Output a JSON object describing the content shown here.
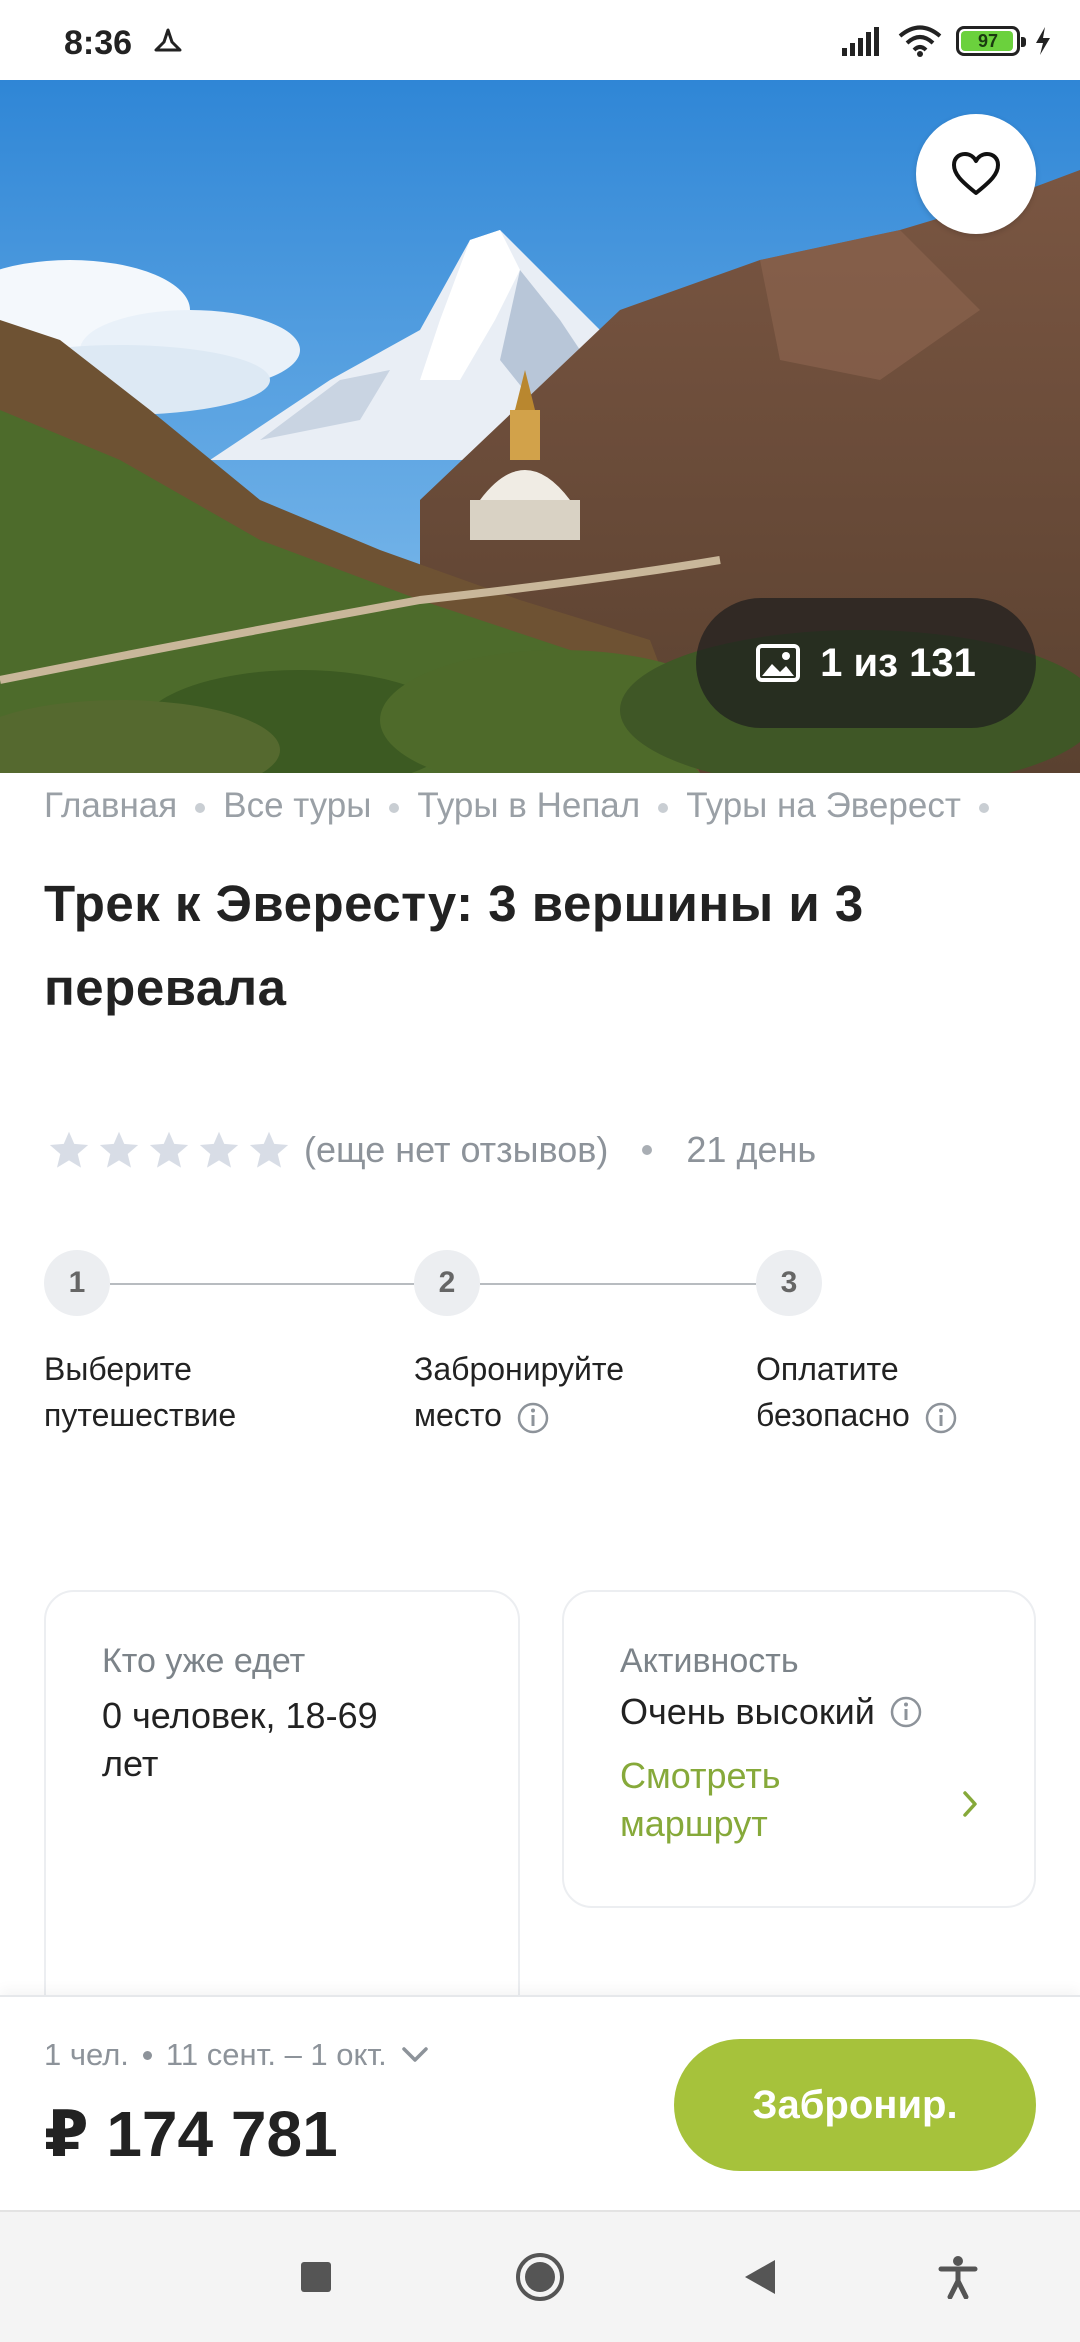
{
  "status_bar": {
    "time": "8:36",
    "battery": "97",
    "battery_level": 0.97
  },
  "hero": {
    "gallery_counter": "1 из 131"
  },
  "breadcrumb": [
    "Главная",
    "Все туры",
    "Туры в Непал",
    "Туры на Эверест"
  ],
  "tour": {
    "title": "Трек к Эвересту: 3 вершины и 3 перевала",
    "rating": 0,
    "rating_max": 5,
    "reviews_text": "(еще нет отзывов)",
    "duration": "21 день"
  },
  "steps": [
    {
      "number": "1",
      "label_line1": "Выберите",
      "label_line2": "путешествие"
    },
    {
      "number": "2",
      "label_line1": "Забронируйте",
      "label_line2": "место"
    },
    {
      "number": "3",
      "label_line1": "Оплатите",
      "label_line2": "безопасно"
    }
  ],
  "cards": {
    "participants": {
      "label": "Кто уже едет",
      "value": "0 человек, 18-69 лет"
    },
    "activity": {
      "label": "Активность",
      "value": "Очень высокий",
      "link_line1": "Смотреть",
      "link_line2": "маршрут"
    }
  },
  "booking": {
    "people": "1 чел.",
    "dates": "11 сент. – 1 окт.",
    "price": "₽ 174 781",
    "button": "Забронир."
  },
  "colors": {
    "accent": "#a6c23b",
    "link": "#86a93a",
    "muted": "#8d939a"
  },
  "icons": [
    "heart-icon",
    "image-icon",
    "star-icon",
    "info-icon",
    "chevron-right-icon",
    "chevron-down-icon",
    "nav-recents-icon",
    "nav-home-icon",
    "nav-back-icon",
    "accessibility-icon"
  ]
}
